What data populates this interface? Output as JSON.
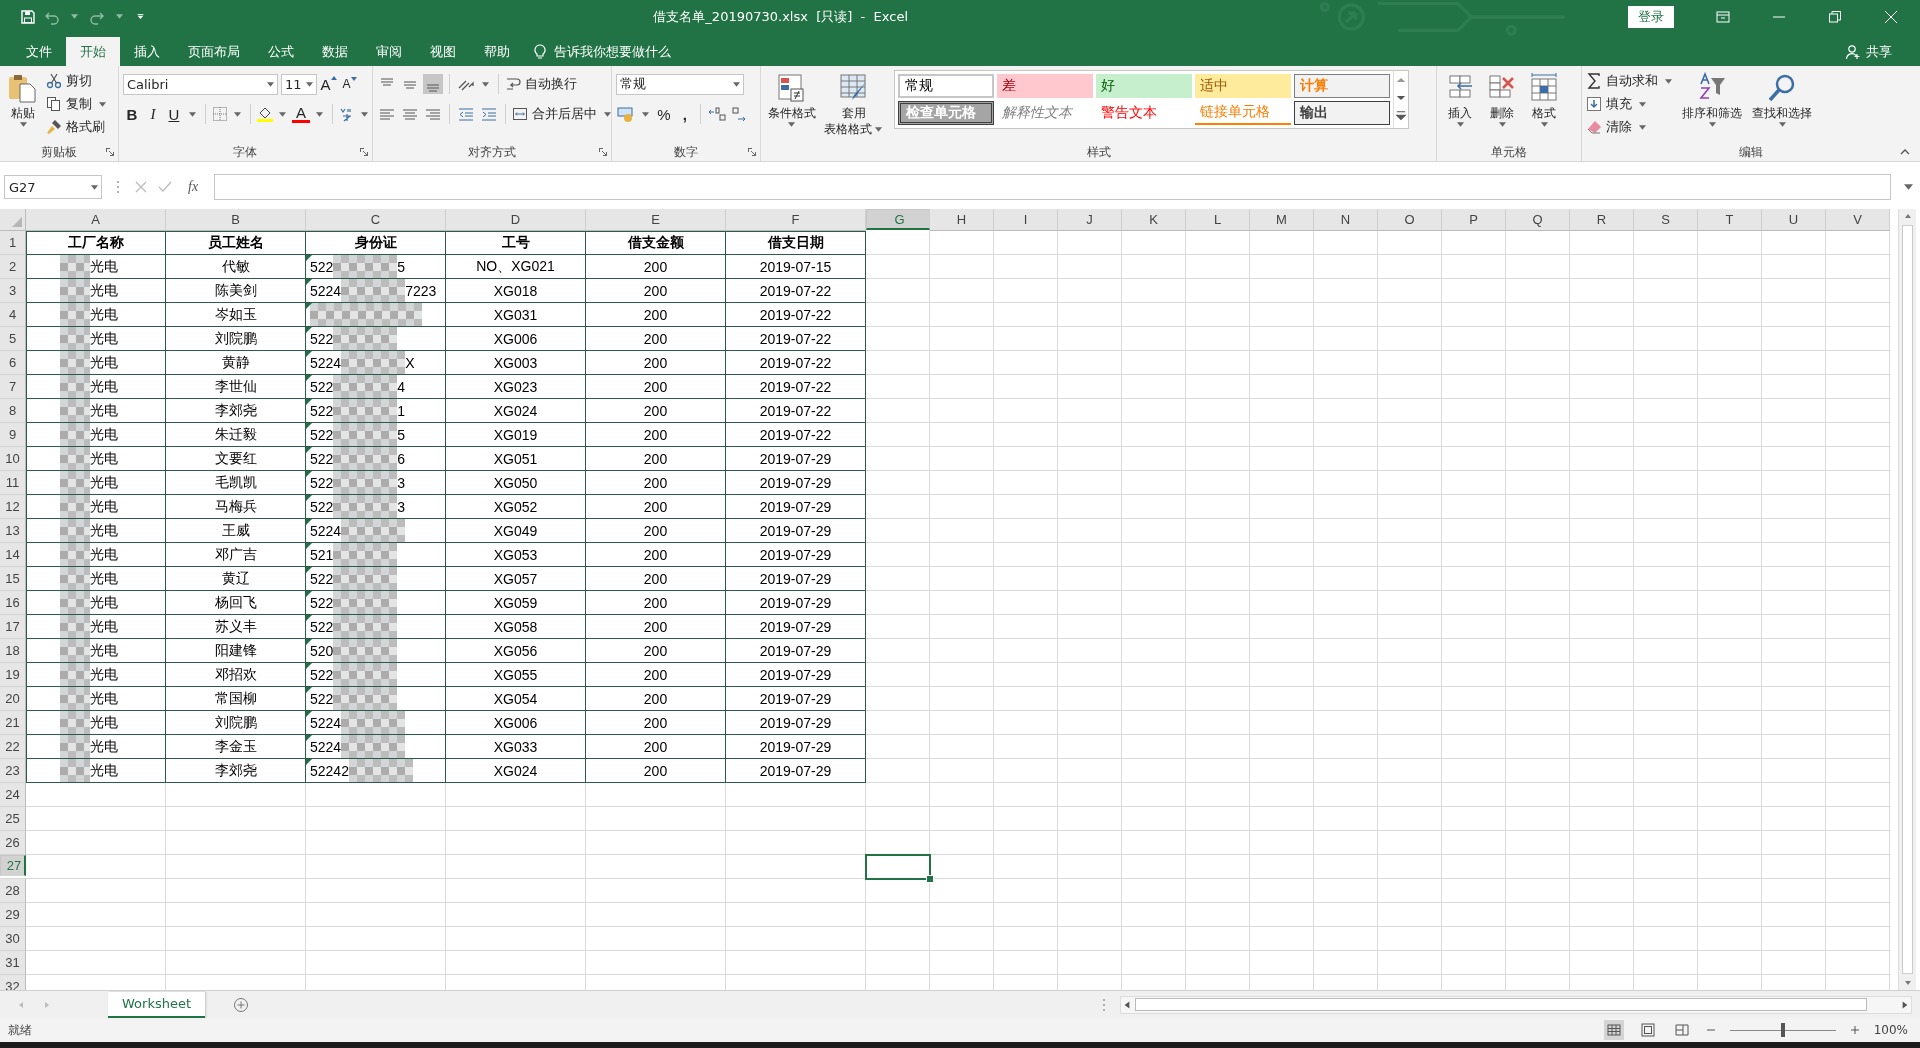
{
  "title_bar": {
    "title": "借支名单_20190730.xlsx  [只读]  -  Excel",
    "login": "登录"
  },
  "menu_tabs": [
    {
      "label": "文件",
      "selected": false
    },
    {
      "label": "开始",
      "selected": true
    },
    {
      "label": "插入",
      "selected": false
    },
    {
      "label": "页面布局",
      "selected": false
    },
    {
      "label": "公式",
      "selected": false
    },
    {
      "label": "数据",
      "selected": false
    },
    {
      "label": "审阅",
      "selected": false
    },
    {
      "label": "视图",
      "selected": false
    },
    {
      "label": "帮助",
      "selected": false
    }
  ],
  "tell_me": "告诉我你想要做什么",
  "share": "共享",
  "ribbon": {
    "clipboard": {
      "paste": "粘贴",
      "cut": "剪切",
      "copy": "复制",
      "format_painter": "格式刷",
      "label": "剪贴板"
    },
    "font": {
      "name": "Calibri",
      "size": "11",
      "grow": "A",
      "shrink": "A",
      "bold": "B",
      "italic": "I",
      "underline": "U",
      "font_color": "A",
      "label": "字体"
    },
    "alignment": {
      "wrap": "自动换行",
      "merge": "合并后居中",
      "label": "对齐方式"
    },
    "number": {
      "format": "常规",
      "percent": "%",
      "comma": ",",
      "label": "数字"
    },
    "styles": {
      "conditional": "条件格式",
      "table_format": "套用",
      "table_format_2": "表格格式",
      "label": "样式",
      "cell_styles": [
        {
          "kind": "normal",
          "label": "常规"
        },
        {
          "kind": "bad",
          "label": "差"
        },
        {
          "kind": "good",
          "label": "好"
        },
        {
          "kind": "neutral",
          "label": "适中"
        },
        {
          "kind": "calculation",
          "label": "计算"
        },
        {
          "kind": "check",
          "label": "检查单元格"
        },
        {
          "kind": "explanatory",
          "label": "解释性文本"
        },
        {
          "kind": "warning",
          "label": "警告文本"
        },
        {
          "kind": "linked",
          "label": "链接单元格"
        },
        {
          "kind": "output",
          "label": "输出"
        }
      ]
    },
    "cells": {
      "insert": "插入",
      "delete": "删除",
      "format": "格式",
      "label": "单元格"
    },
    "editing": {
      "autosum": "自动求和",
      "fill": "填充",
      "clear": "清除",
      "sort": "排序和筛选",
      "find": "查找和选择",
      "label": "编辑"
    }
  },
  "formula_bar": {
    "name_box": "G27",
    "fx": "fx"
  },
  "sheet": {
    "columns": [
      {
        "label": "A",
        "selected": false
      },
      {
        "label": "B",
        "selected": false
      },
      {
        "label": "C",
        "selected": false
      },
      {
        "label": "D",
        "selected": false
      },
      {
        "label": "E",
        "selected": false
      },
      {
        "label": "F",
        "selected": false
      },
      {
        "label": "G",
        "selected": true
      },
      {
        "label": "H",
        "selected": false
      },
      {
        "label": "I",
        "selected": false
      },
      {
        "label": "J",
        "selected": false
      },
      {
        "label": "K",
        "selected": false
      },
      {
        "label": "L",
        "selected": false
      },
      {
        "label": "M",
        "selected": false
      },
      {
        "label": "N",
        "selected": false
      },
      {
        "label": "O",
        "selected": false
      },
      {
        "label": "P",
        "selected": false
      },
      {
        "label": "Q",
        "selected": false
      },
      {
        "label": "R",
        "selected": false
      },
      {
        "label": "S",
        "selected": false
      },
      {
        "label": "T",
        "selected": false
      },
      {
        "label": "U",
        "selected": false
      },
      {
        "label": "V",
        "selected": false
      }
    ],
    "row_headers": [
      {
        "label": "1",
        "selected": false
      },
      {
        "label": "2",
        "selected": false
      },
      {
        "label": "3",
        "selected": false
      },
      {
        "label": "4",
        "selected": false
      },
      {
        "label": "5",
        "selected": false
      },
      {
        "label": "6",
        "selected": false
      },
      {
        "label": "7",
        "selected": false
      },
      {
        "label": "8",
        "selected": false
      },
      {
        "label": "9",
        "selected": false
      },
      {
        "label": "10",
        "selected": false
      },
      {
        "label": "11",
        "selected": false
      },
      {
        "label": "12",
        "selected": false
      },
      {
        "label": "13",
        "selected": false
      },
      {
        "label": "14",
        "selected": false
      },
      {
        "label": "15",
        "selected": false
      },
      {
        "label": "16",
        "selected": false
      },
      {
        "label": "17",
        "selected": false
      },
      {
        "label": "18",
        "selected": false
      },
      {
        "label": "19",
        "selected": false
      },
      {
        "label": "20",
        "selected": false
      },
      {
        "label": "21",
        "selected": false
      },
      {
        "label": "22",
        "selected": false
      },
      {
        "label": "23",
        "selected": false
      },
      {
        "label": "24",
        "selected": false
      },
      {
        "label": "25",
        "selected": false
      },
      {
        "label": "26",
        "selected": false
      },
      {
        "label": "27",
        "selected": true
      },
      {
        "label": "28",
        "selected": false
      },
      {
        "label": "29",
        "selected": false
      },
      {
        "label": "30",
        "selected": false
      },
      {
        "label": "31",
        "selected": false
      },
      {
        "label": "32",
        "selected": false
      }
    ],
    "header": [
      "工厂名称",
      "员工姓名",
      "身份证",
      "工号",
      "借支金额",
      "借支日期"
    ],
    "rows": [
      {
        "factory": "光电",
        "name": "代敏",
        "id_start": "522",
        "id_end": "5",
        "code": "NO、XG021",
        "amount": "200",
        "date": "2019-07-15"
      },
      {
        "factory": "光电",
        "name": "陈美剑",
        "id_start": "5224",
        "id_end": "7223",
        "code": "XG018",
        "amount": "200",
        "date": "2019-07-22"
      },
      {
        "factory": "光电",
        "name": "岑如玉",
        "code": "XG031",
        "amount": "200",
        "date": "2019-07-22"
      },
      {
        "factory": "光电",
        "name": "刘院鹏",
        "id_start": "522",
        "code": "XG006",
        "amount": "200",
        "date": "2019-07-22"
      },
      {
        "factory": "光电",
        "name": "黄静",
        "id_start": "5224",
        "id_end": "X",
        "code": "XG003",
        "amount": "200",
        "date": "2019-07-22"
      },
      {
        "factory": "光电",
        "name": "李世仙",
        "id_start": "522",
        "id_end": "4",
        "code": "XG023",
        "amount": "200",
        "date": "2019-07-22"
      },
      {
        "factory": "光电",
        "name": "李郊尧",
        "id_start": "522",
        "id_end": "1",
        "code": "XG024",
        "amount": "200",
        "date": "2019-07-22"
      },
      {
        "factory": "光电",
        "name": "朱迁毅",
        "id_start": "522",
        "id_end": "5",
        "code": "XG019",
        "amount": "200",
        "date": "2019-07-22"
      },
      {
        "factory": "光电",
        "name": "文要红",
        "id_start": "522",
        "id_end": "6",
        "code": "XG051",
        "amount": "200",
        "date": "2019-07-29"
      },
      {
        "factory": "光电",
        "name": "毛凯凯",
        "id_start": "522",
        "id_end": "3",
        "code": "XG050",
        "amount": "200",
        "date": "2019-07-29"
      },
      {
        "factory": "光电",
        "name": "马梅兵",
        "id_start": "522",
        "id_end": "3",
        "code": "XG052",
        "amount": "200",
        "date": "2019-07-29"
      },
      {
        "factory": "光电",
        "name": "王威",
        "id_start": "5224",
        "code": "XG049",
        "amount": "200",
        "date": "2019-07-29"
      },
      {
        "factory": "光电",
        "name": "邓广吉",
        "id_start": "521",
        "code": "XG053",
        "amount": "200",
        "date": "2019-07-29"
      },
      {
        "factory": "光电",
        "name": "黄辽",
        "id_start": "522",
        "code": "XG057",
        "amount": "200",
        "date": "2019-07-29"
      },
      {
        "factory": "光电",
        "name": "杨回飞",
        "id_start": "522",
        "code": "XG059",
        "amount": "200",
        "date": "2019-07-29"
      },
      {
        "factory": "光电",
        "name": "苏义丰",
        "id_start": "522",
        "code": "XG058",
        "amount": "200",
        "date": "2019-07-29"
      },
      {
        "factory": "光电",
        "name": "阳建锋",
        "id_start": "520",
        "code": "XG056",
        "amount": "200",
        "date": "2019-07-29"
      },
      {
        "factory": "光电",
        "name": "邓招欢",
        "id_start": "522",
        "code": "XG055",
        "amount": "200",
        "date": "2019-07-29"
      },
      {
        "factory": "光电",
        "name": "常国柳",
        "id_start": "522",
        "code": "XG054",
        "amount": "200",
        "date": "2019-07-29"
      },
      {
        "factory": "光电",
        "name": "刘院鹏",
        "id_start": "5224",
        "code": "XG006",
        "amount": "200",
        "date": "2019-07-29"
      },
      {
        "factory": "光电",
        "name": "李金玉",
        "id_start": "5224",
        "code": "XG033",
        "amount": "200",
        "date": "2019-07-29"
      },
      {
        "factory": "光电",
        "name": "李郊尧",
        "id_start": "52242",
        "code": "XG024",
        "amount": "200",
        "date": "2019-07-29"
      }
    ]
  },
  "sheet_tabs": [
    {
      "label": "Worksheet",
      "selected": true
    }
  ],
  "status_bar": {
    "status": "就绪",
    "views": [
      {
        "kind": "normal",
        "selected": true
      },
      {
        "kind": "page_layout",
        "selected": false
      },
      {
        "kind": "page_break",
        "selected": false
      }
    ],
    "zoom": {
      "level": 0.5,
      "reading": "100%"
    }
  }
}
